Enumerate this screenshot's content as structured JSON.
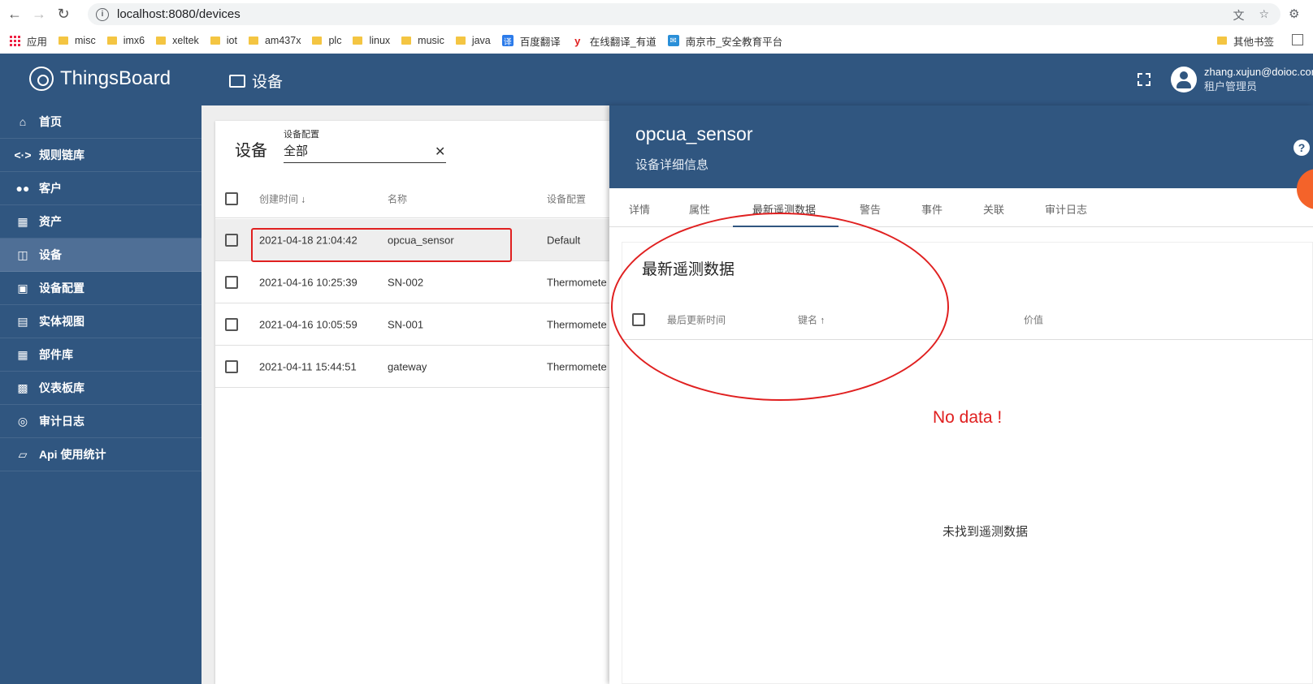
{
  "browser": {
    "url": "localhost:8080/devices",
    "bookmarks": [
      "应用",
      "misc",
      "imx6",
      "xeltek",
      "iot",
      "am437x",
      "plc",
      "linux",
      "music",
      "java",
      "百度翻译",
      "在线翻译_有道",
      "南京市_安全教育平台"
    ],
    "other_bookmarks": "其他书签"
  },
  "header": {
    "logo_text": "ThingsBoard",
    "page_title": "设备",
    "user_email": "zhang.xujun@doioc.cor",
    "user_role": "租户管理员"
  },
  "sidebar": {
    "items": [
      {
        "label": "首页",
        "icon": "home-icon"
      },
      {
        "label": "规则链库",
        "icon": "code-arrows-icon"
      },
      {
        "label": "客户",
        "icon": "people-icon"
      },
      {
        "label": "资产",
        "icon": "building-icon"
      },
      {
        "label": "设备",
        "icon": "devices-icon"
      },
      {
        "label": "设备配置",
        "icon": "profile-icon"
      },
      {
        "label": "实体视图",
        "icon": "view-icon"
      },
      {
        "label": "部件库",
        "icon": "widgets-icon"
      },
      {
        "label": "仪表板库",
        "icon": "dashboard-icon"
      },
      {
        "label": "审计日志",
        "icon": "audit-icon"
      },
      {
        "label": "Api 使用统计",
        "icon": "chart-icon"
      }
    ]
  },
  "devices": {
    "title": "设备",
    "filter_label": "设备配置",
    "filter_value": "全部",
    "columns": [
      "创建时间",
      "名称",
      "设备配置"
    ],
    "rows": [
      {
        "created": "2021-04-18 21:04:42",
        "name": "opcua_sensor",
        "profile": "Default"
      },
      {
        "created": "2021-04-16 10:25:39",
        "name": "SN-002",
        "profile": "Thermomete"
      },
      {
        "created": "2021-04-16 10:05:59",
        "name": "SN-001",
        "profile": "Thermomete"
      },
      {
        "created": "2021-04-11 15:44:51",
        "name": "gateway",
        "profile": "Thermomete"
      }
    ]
  },
  "detail": {
    "title": "opcua_sensor",
    "subtitle": "设备详细信息",
    "tabs": [
      "详情",
      "属性",
      "最新遥测数据",
      "警告",
      "事件",
      "关联",
      "审计日志"
    ],
    "telemetry_title": "最新遥测数据",
    "telemetry_columns": [
      "最后更新时间",
      "键名",
      "价值"
    ],
    "annotation": "No data !",
    "empty_message": "未找到遥测数据"
  }
}
